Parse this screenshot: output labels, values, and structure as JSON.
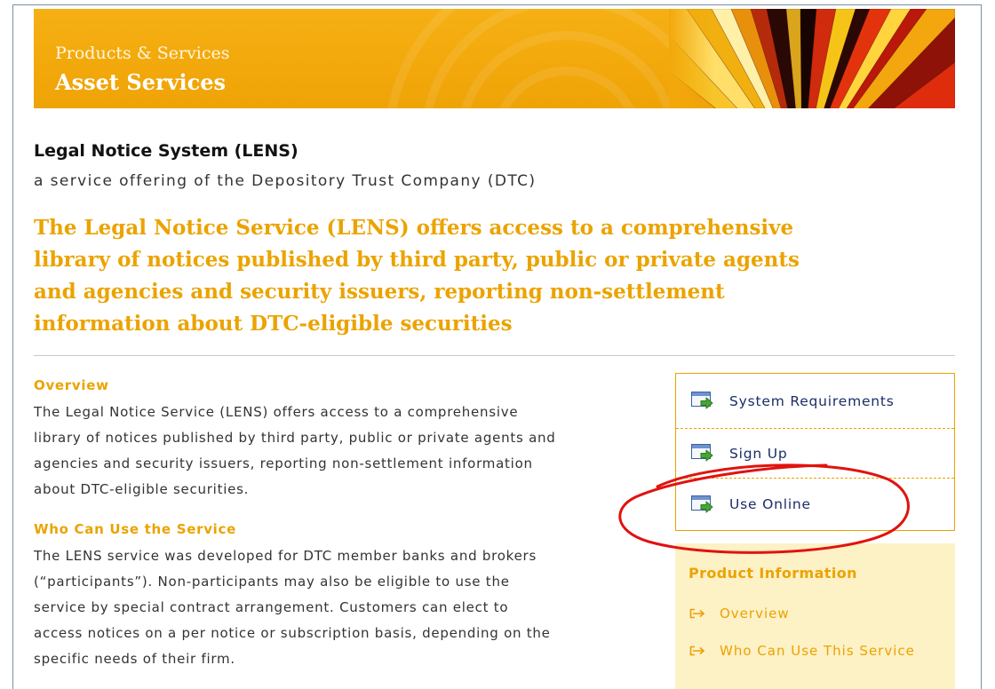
{
  "banner": {
    "section_label": "Products & Services",
    "title": "Asset Services"
  },
  "page": {
    "title": "Legal Notice System (LENS)",
    "subtitle": "a service offering of the Depository Trust Company (DTC)",
    "headline_lines": [
      "The Legal Notice Service (LENS) offers access to a comprehensive",
      "library of notices published by third party, public or private agents",
      "and agencies and security issuers, reporting non-settlement",
      "information about DTC-eligible securities"
    ]
  },
  "sections": [
    {
      "heading": "Overview",
      "lines": [
        "The Legal Notice Service (LENS) offers access to a comprehensive",
        "library of notices published by third party, public or private agents and",
        "agencies and security issuers, reporting non-settlement information",
        "about DTC-eligible securities."
      ]
    },
    {
      "heading": "Who Can Use the Service",
      "lines": [
        "The LENS service was developed for DTC member banks and brokers",
        "(“participants”). Non-participants may also be eligible to use the",
        "service by special contract arrangement. Customers can elect to",
        "access notices on a per notice or subscription basis, depending on the",
        "specific needs of their firm."
      ]
    }
  ],
  "actions": [
    {
      "label": "System Requirements",
      "icon": "window-arrow-icon"
    },
    {
      "label": "Sign Up",
      "icon": "window-arrow-icon"
    },
    {
      "label": "Use Online",
      "icon": "window-arrow-icon"
    }
  ],
  "product_info": {
    "title": "Product Information",
    "links": [
      {
        "label": "Overview",
        "icon": "arrow-out-icon"
      },
      {
        "label": "Who Can Use This Service",
        "icon": "arrow-out-icon"
      }
    ]
  },
  "colors": {
    "accent_orange": "#eba300",
    "banner_orange": "#f2a80b",
    "link_navy": "#1c2d68",
    "panel_cream": "#fdf1c6",
    "annotation_red": "#e0130f",
    "frame": "#7d8ea3"
  }
}
